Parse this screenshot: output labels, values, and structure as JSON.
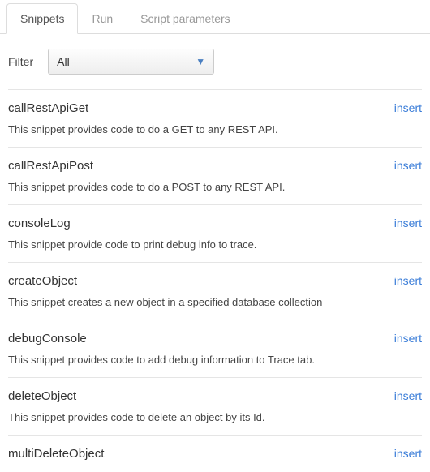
{
  "tabs": {
    "snippets": "Snippets",
    "run": "Run",
    "script_parameters": "Script parameters"
  },
  "filter": {
    "label": "Filter",
    "selected": "All"
  },
  "insert_label": "insert",
  "snippets": [
    {
      "name": "callRestApiGet",
      "description": "This snippet provides code to do a GET to any REST API."
    },
    {
      "name": "callRestApiPost",
      "description": "This snippet provides code to do a POST to any REST API."
    },
    {
      "name": "consoleLog",
      "description": "This snippet provide code to print debug info to trace."
    },
    {
      "name": "createObject",
      "description": "This snippet creates a new object in a specified database collection"
    },
    {
      "name": "debugConsole",
      "description": "This snippet provides code to add debug information to Trace tab."
    },
    {
      "name": "deleteObject",
      "description": "This snippet provides code to delete an object by its Id."
    },
    {
      "name": "multiDeleteObject",
      "description": ""
    }
  ]
}
